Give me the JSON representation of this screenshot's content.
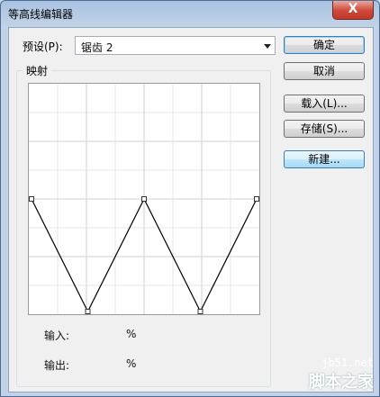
{
  "window": {
    "title": "等高线编辑器",
    "close_glyph": "X"
  },
  "preset": {
    "label": "预设(P):",
    "value": "锯齿 2"
  },
  "buttons": {
    "ok": "确定",
    "cancel": "取消",
    "load": "载入(L)...",
    "save": "存储(S)...",
    "new": "新建..."
  },
  "mapping": {
    "label": "映射"
  },
  "readouts": {
    "input_label": "输入:",
    "input_unit": "%",
    "output_label": "输出:",
    "output_unit": "%"
  },
  "contour": {
    "points": [
      {
        "input": 0,
        "output": 50
      },
      {
        "input": 25,
        "output": 0
      },
      {
        "input": 50,
        "output": 50
      },
      {
        "input": 75,
        "output": 0
      },
      {
        "input": 100,
        "output": 50
      }
    ]
  },
  "watermark": {
    "url": "jb51.net",
    "name": "脚本之家"
  }
}
